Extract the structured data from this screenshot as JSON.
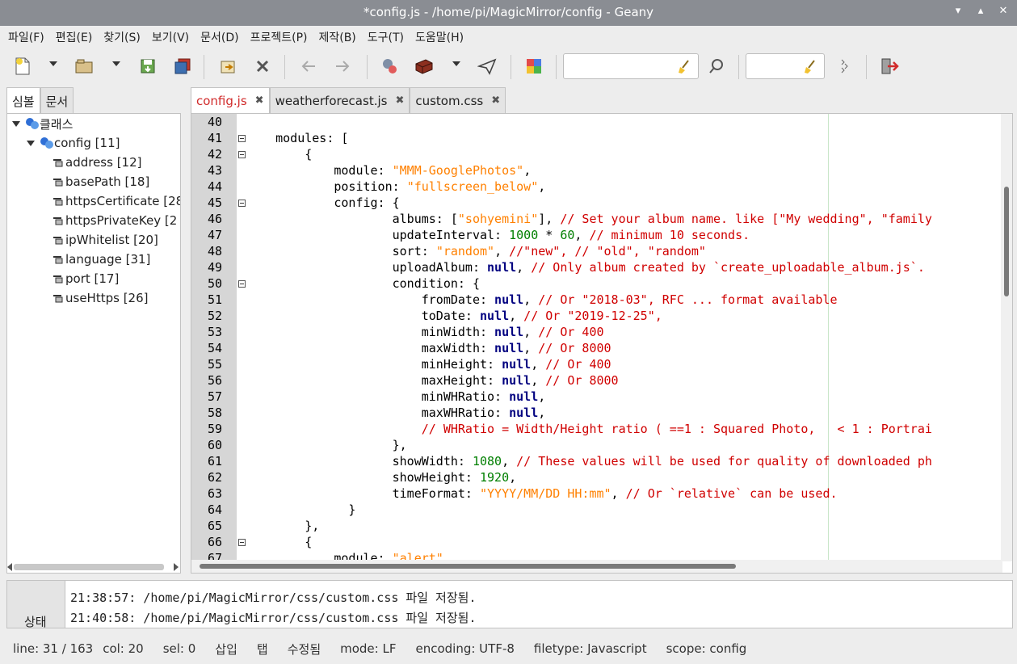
{
  "window": {
    "title": "*config.js - /home/pi/MagicMirror/config - Geany"
  },
  "menu": [
    "파일(F)",
    "편집(E)",
    "찾기(S)",
    "보기(V)",
    "문서(D)",
    "프로젝트(P)",
    "제작(B)",
    "도구(T)",
    "도움말(H)"
  ],
  "sidebar": {
    "tabs": [
      "심볼",
      "문서"
    ],
    "root": "클래스",
    "class": "config [11]",
    "items": [
      "address [12]",
      "basePath [18]",
      "httpsCertificate [28",
      "httpsPrivateKey [2",
      "ipWhitelist [20]",
      "language [31]",
      "port [17]",
      "useHttps [26]"
    ]
  },
  "editor": {
    "tabs": [
      "config.js",
      "weatherforecast.js",
      "custom.css"
    ],
    "line_numbers": [
      "40",
      "41",
      "42",
      "43",
      "44",
      "45",
      "46",
      "47",
      "48",
      "49",
      "50",
      "51",
      "52",
      "53",
      "54",
      "55",
      "56",
      "57",
      "58",
      "59",
      "60",
      "61",
      "62",
      "63",
      "64",
      "65",
      "66",
      "67"
    ]
  },
  "messages": {
    "tab": "상태",
    "lines": [
      "21:38:57: /home/pi/MagicMirror/css/custom.css 파일 저장됨.",
      "21:40:58: /home/pi/MagicMirror/css/custom.css 파일 저장됨."
    ]
  },
  "status": {
    "line": "line: 31 / 163",
    "col": "col: 20",
    "sel": "sel: 0",
    "insert": "삽입",
    "tab": "탭",
    "modified": "수정됨",
    "mode": "mode: LF",
    "encoding": "encoding: UTF-8",
    "filetype": "filetype: Javascript",
    "scope": "scope: config"
  }
}
